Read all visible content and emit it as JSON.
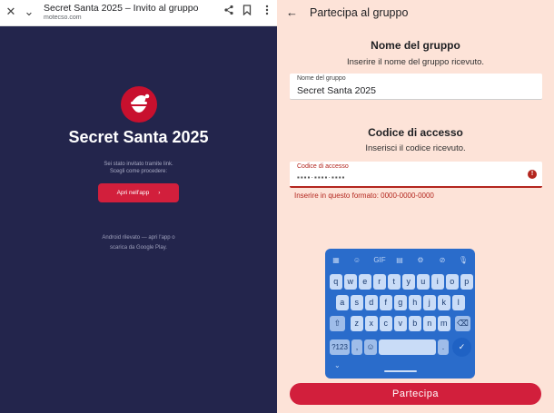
{
  "left": {
    "browser": {
      "tab_title": "Secret Santa 2025 – Invito al gruppo",
      "domain": "motecso.com"
    },
    "app_title": "Secret Santa 2025",
    "invite_line1": "Sei stato invitato tramite link.",
    "invite_line2": "Scegli come procedere:",
    "open_app_label": "Apri nell'app",
    "note_line1": "Android rilevato — apri l'app o",
    "note_line2": "scarica da Google Play."
  },
  "right": {
    "screen_title": "Partecipa al gruppo",
    "group_section": {
      "title": "Nome del gruppo",
      "helper": "Inserire il nome del gruppo ricevuto.",
      "field_label": "Nome del gruppo",
      "field_value": "Secret Santa 2025"
    },
    "code_section": {
      "title": "Codice di accesso",
      "helper": "Inserisci il codice ricevuto.",
      "field_label": "Codice di accesso",
      "field_value": "▪▪▪▪·▪▪▪▪·▪▪▪▪",
      "error": "Inserire in questo formato: 0000-0000-0000"
    },
    "join_label": "Partecipa"
  },
  "keyboard": {
    "gif_label": "GIF",
    "row1": [
      "q",
      "w",
      "e",
      "r",
      "t",
      "y",
      "u",
      "i",
      "o",
      "p"
    ],
    "row2": [
      "a",
      "s",
      "d",
      "f",
      "g",
      "h",
      "j",
      "k",
      "l"
    ],
    "row3": [
      "z",
      "x",
      "c",
      "v",
      "b",
      "n",
      "m"
    ],
    "sym_label": "?123",
    "comma": ",",
    "period": "."
  },
  "colors": {
    "left_bg": "#23254c",
    "right_bg": "#fde3d8",
    "brand_red": "#d21f3c",
    "error_red": "#b3261e",
    "keyboard_blue": "#2a6ccb"
  }
}
